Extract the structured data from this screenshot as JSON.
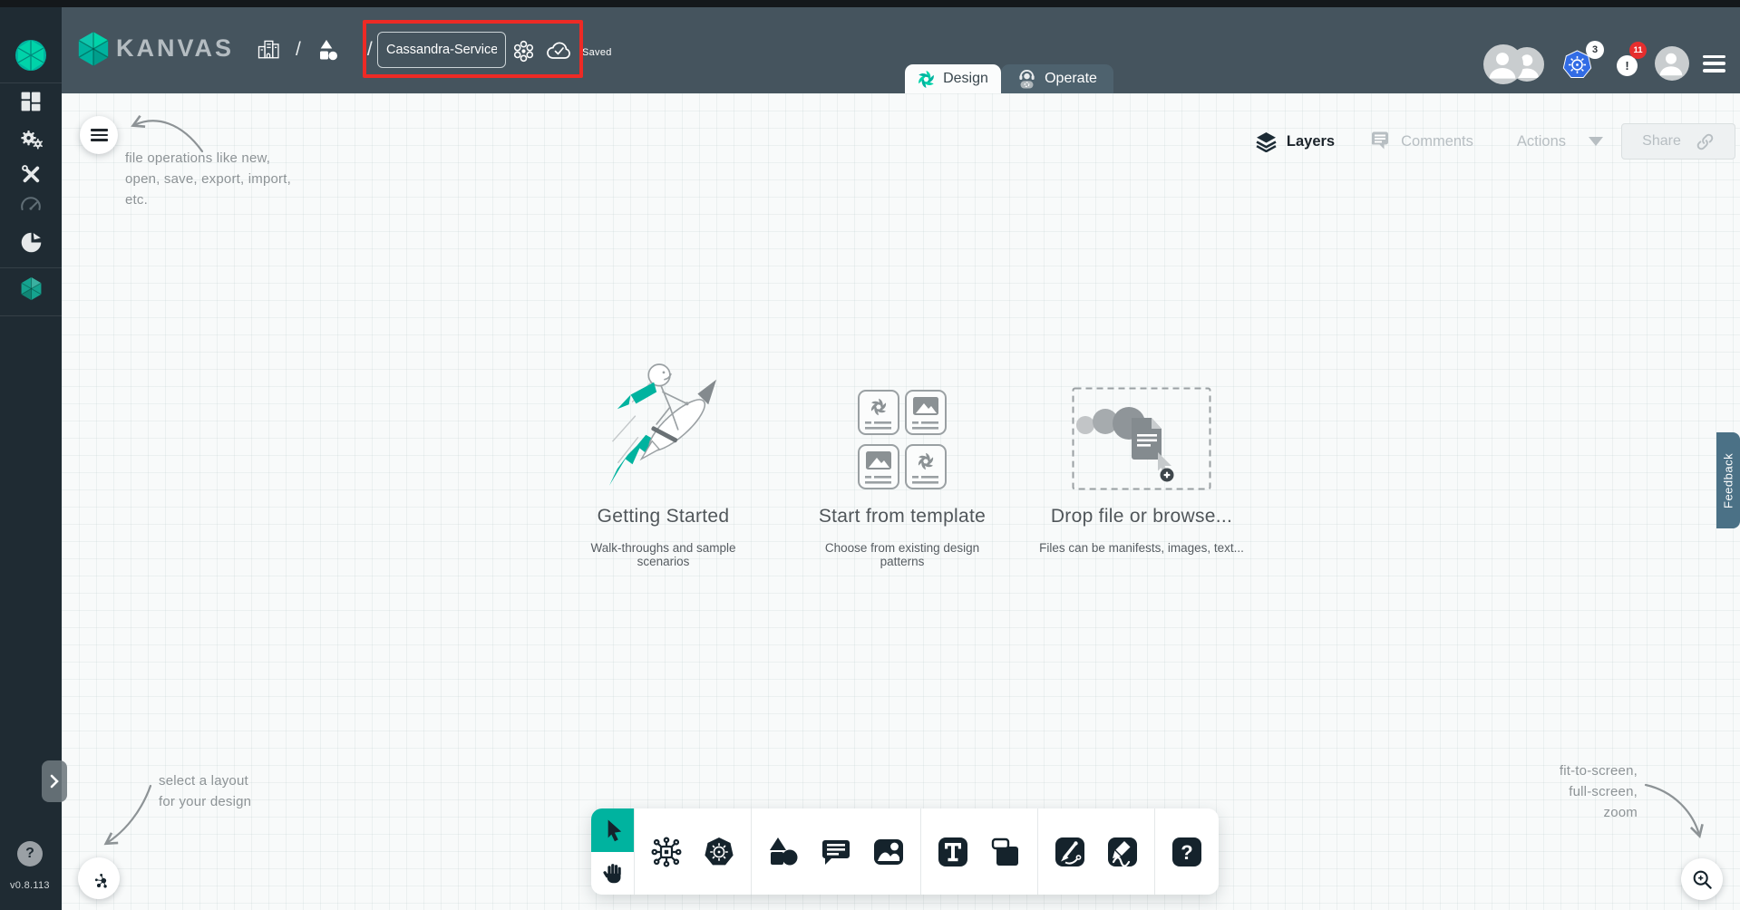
{
  "app": {
    "name": "KANVAS",
    "version": "v0.8.113"
  },
  "header": {
    "file": {
      "name": "Cassandra-Service",
      "status": "Saved"
    },
    "tabs": [
      {
        "label": "Design",
        "active": true
      },
      {
        "label": "Operate",
        "active": false
      }
    ],
    "badges": {
      "kubernetes_contexts": "3",
      "notifications": "11"
    }
  },
  "sidebar": {
    "nav": [
      "dashboard",
      "lifecycle",
      "configuration",
      "performance",
      "extensions",
      "kanvas"
    ],
    "version": "v0.8.113"
  },
  "design_bar": {
    "layers": "Layers",
    "comments": "Comments",
    "actions": "Actions",
    "share": "Share"
  },
  "canvas": {
    "cards": [
      {
        "title": "Getting Started",
        "subtitle": "Walk-throughs and sample scenarios"
      },
      {
        "title": "Start from template",
        "subtitle": "Choose from existing design patterns"
      },
      {
        "title": "Drop file or browse...",
        "subtitle": "Files can be manifests, images, text..."
      }
    ],
    "annotations": {
      "file_operations": {
        "line1": "file operations like new,",
        "line2": "open, save, export, import,",
        "line3": "etc."
      },
      "layout": {
        "line1": "select a layout",
        "line2": "for your design"
      },
      "zoom": {
        "line1": "fit-to-screen,",
        "line2": "full-screen,",
        "line3": "zoom"
      }
    }
  },
  "toolbar": {
    "tools": [
      "select",
      "pan",
      "component",
      "kubernetes",
      "shapes",
      "comment",
      "media",
      "text",
      "note",
      "pen",
      "draw",
      "help"
    ]
  },
  "feedback": {
    "label": "Feedback"
  },
  "glyphs": {
    "slash": "/",
    "help": "?",
    "alert": "!",
    "chevron": "›"
  },
  "colors": {
    "accent_teal": "#00b39f",
    "teal_light": "#00d3a9",
    "header": "#45545e",
    "sidebar": "#1f2b33",
    "kubernetes_blue": "#326ce5",
    "alert_red": "#e62e2e",
    "highlight_red": "#ee2a25",
    "canvas": "#f8fafa",
    "feedback_tab": "#4b7186"
  }
}
